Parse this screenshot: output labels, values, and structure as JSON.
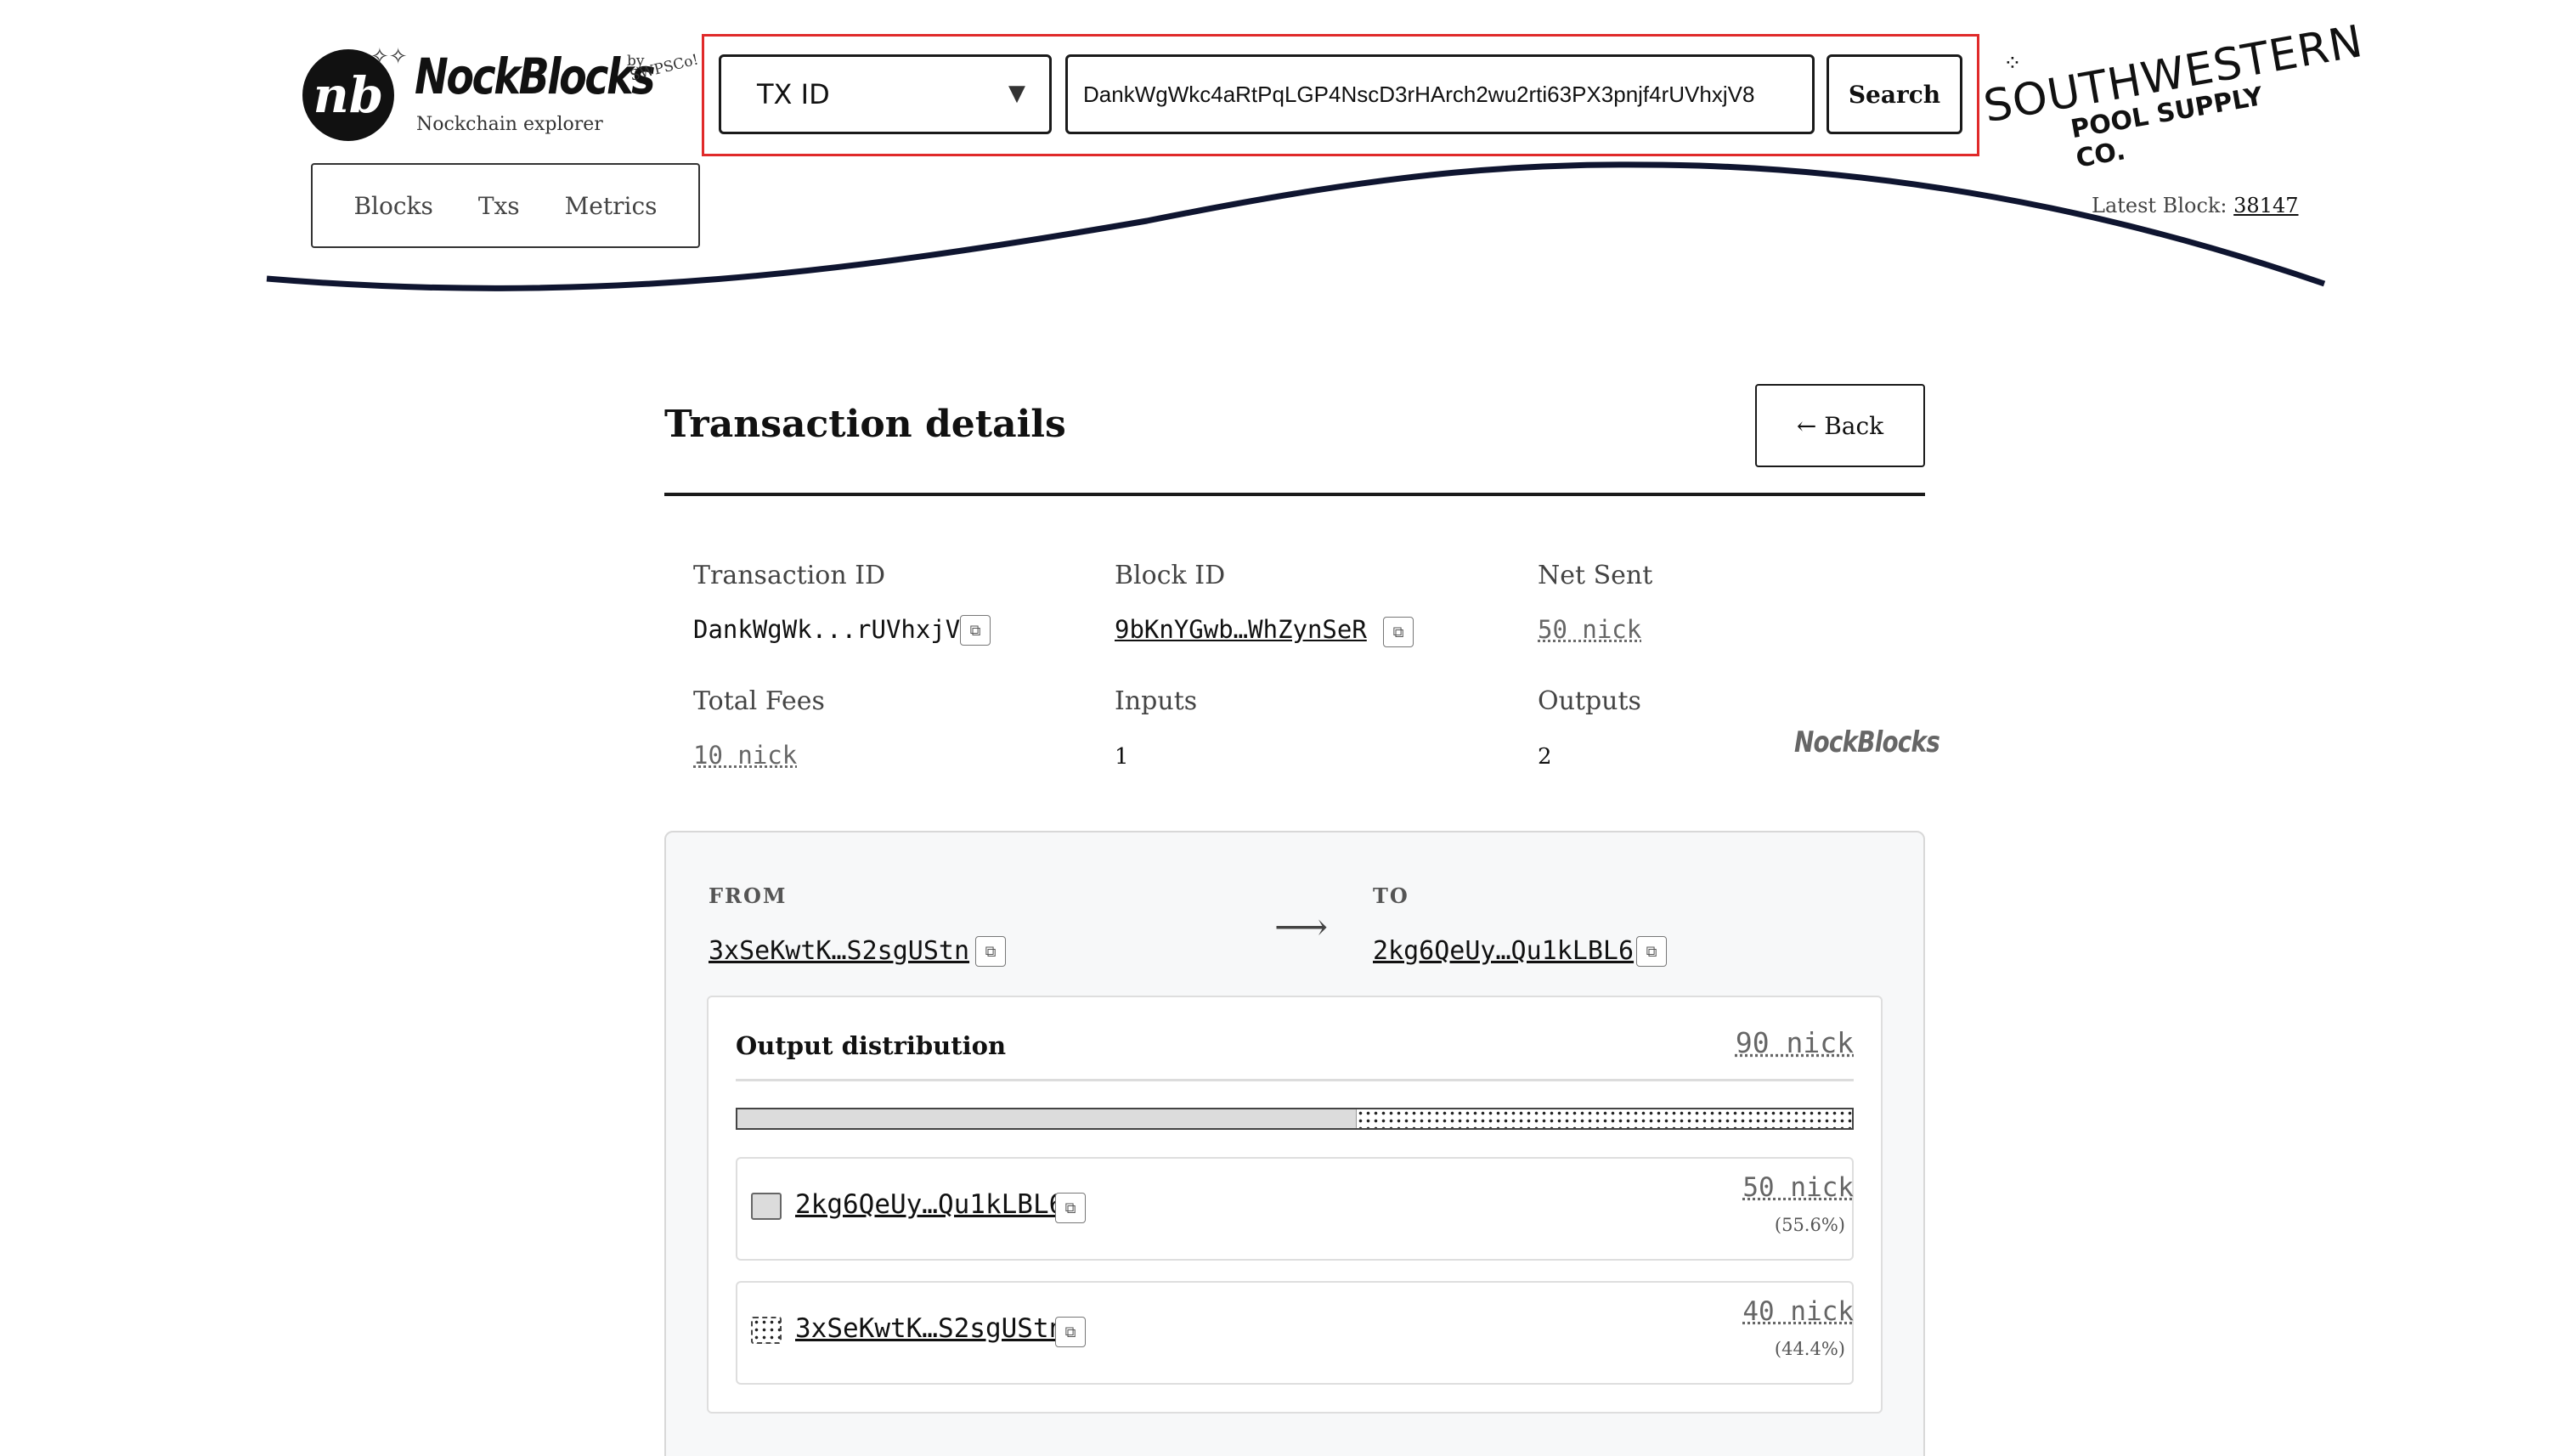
{
  "header": {
    "brand": "NockBlocks",
    "brand_subtitle": "Nockchain explorer",
    "brand_by": "by",
    "brand_swp": "SWPSCo!",
    "logo_icon": "nb-monogram-icon",
    "search_type_selected": "TX ID",
    "search_value": "DankWgWkc4aRtPqLGP4NscD3rHArch2wu2rti63PX3pnjf4rUVhxjV8",
    "search_button": "Search",
    "sponsor_line1": "SOUTHWESTERN",
    "sponsor_line2": "POOL SUPPLY CO.",
    "nav": [
      "Blocks",
      "Txs",
      "Metrics"
    ],
    "latest_block_label": "Latest Block:",
    "latest_block_value": "38147"
  },
  "main": {
    "title": "Transaction details",
    "back_label": "← Back",
    "fields": {
      "transaction_id_label": "Transaction ID",
      "transaction_id_value": "DankWgWk...rUVhxjV8",
      "block_id_label": "Block ID",
      "block_id_value": "9bKnYGwb…WhZynSeR",
      "net_sent_label": "Net Sent",
      "net_sent_value": "50 nick",
      "total_fees_label": "Total Fees",
      "total_fees_value": "10 nick",
      "inputs_label": "Inputs",
      "inputs_value": "1",
      "outputs_label": "Outputs",
      "outputs_value": "2"
    },
    "watermark": "NockBlocks"
  },
  "transfer": {
    "from_label": "FROM",
    "from_address": "3xSeKwtK…S2sgUStn",
    "to_label": "TO",
    "to_address": "2kg6QeUy…Qu1kLBL6"
  },
  "distribution": {
    "title": "Output distribution",
    "total": "90 nick",
    "outputs": [
      {
        "address": "2kg6QeUy…Qu1kLBL6",
        "amount": "50 nick",
        "percent": "(55.6%)",
        "fraction": 0.556,
        "pattern": "solid"
      },
      {
        "address": "3xSeKwtK…S2sgUStn",
        "amount": "40 nick",
        "percent": "(44.4%)",
        "fraction": 0.444,
        "pattern": "dotted"
      }
    ]
  },
  "colors": {
    "highlight_border": "#e02a2a",
    "wave": "#0f1530",
    "bar_solid": "#dcdcdc"
  }
}
